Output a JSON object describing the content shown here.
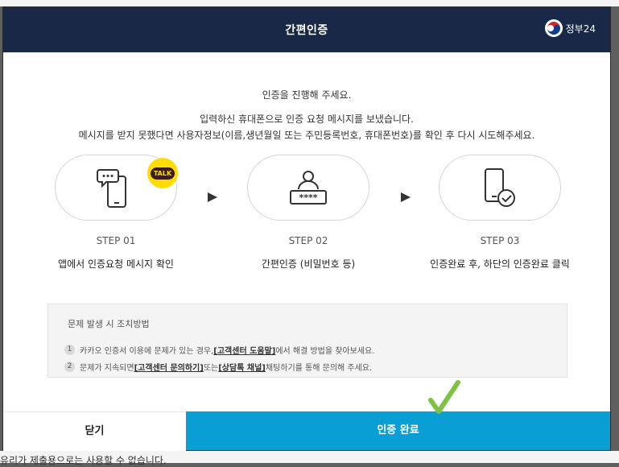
{
  "background": {
    "text": "유리가 제출용으로는 사용할 수 없습니다."
  },
  "header": {
    "title": "간편인증",
    "logo_text": "정부24"
  },
  "intro": {
    "line1": "인증을 진행해 주세요.",
    "line2": "입력하신 휴대폰으로 인증 요청 메시지를 보냈습니다.",
    "line3": "메시지를 받지 못했다면 사용자정보(이름,생년월일 또는 주민등록번호, 휴대폰번호)를 확인 후 다시 시도해주세요."
  },
  "steps": [
    {
      "label": "STEP 01",
      "desc": "앱에서 인증요청 메시지 확인",
      "icon": "phone-chat-icon",
      "badge": "TALK"
    },
    {
      "label": "STEP 02",
      "desc": "간편인증 (비밀번호 등)",
      "icon": "password-user-icon"
    },
    {
      "label": "STEP 03",
      "desc": "인증완료 후, 하단의 인증완료 클릭",
      "icon": "phone-check-icon"
    }
  ],
  "notice": {
    "title": "문제 발생 시 조치방법",
    "items": [
      {
        "num": "1",
        "pre": "카카오 인증서 이용에 문제가 있는 경우, ",
        "link": "[고객센터 도움말]",
        "post": " 에서 해결 방법을 찾아보세요."
      },
      {
        "num": "2",
        "pre": "문제가 지속되면 ",
        "link": "[고객센터 문의하기]",
        "mid": " 또는 ",
        "link2": "[상담톡 채널]",
        "post": " 채팅하기를 통해 문의해 주세요."
      }
    ]
  },
  "buttons": {
    "close": "닫기",
    "confirm": "인증 완료"
  },
  "colors": {
    "header_bg": "#1a2848",
    "confirm_bg": "#0a9fd4",
    "kakao_yellow": "#ffdc00",
    "check_green": "#7dc242"
  }
}
